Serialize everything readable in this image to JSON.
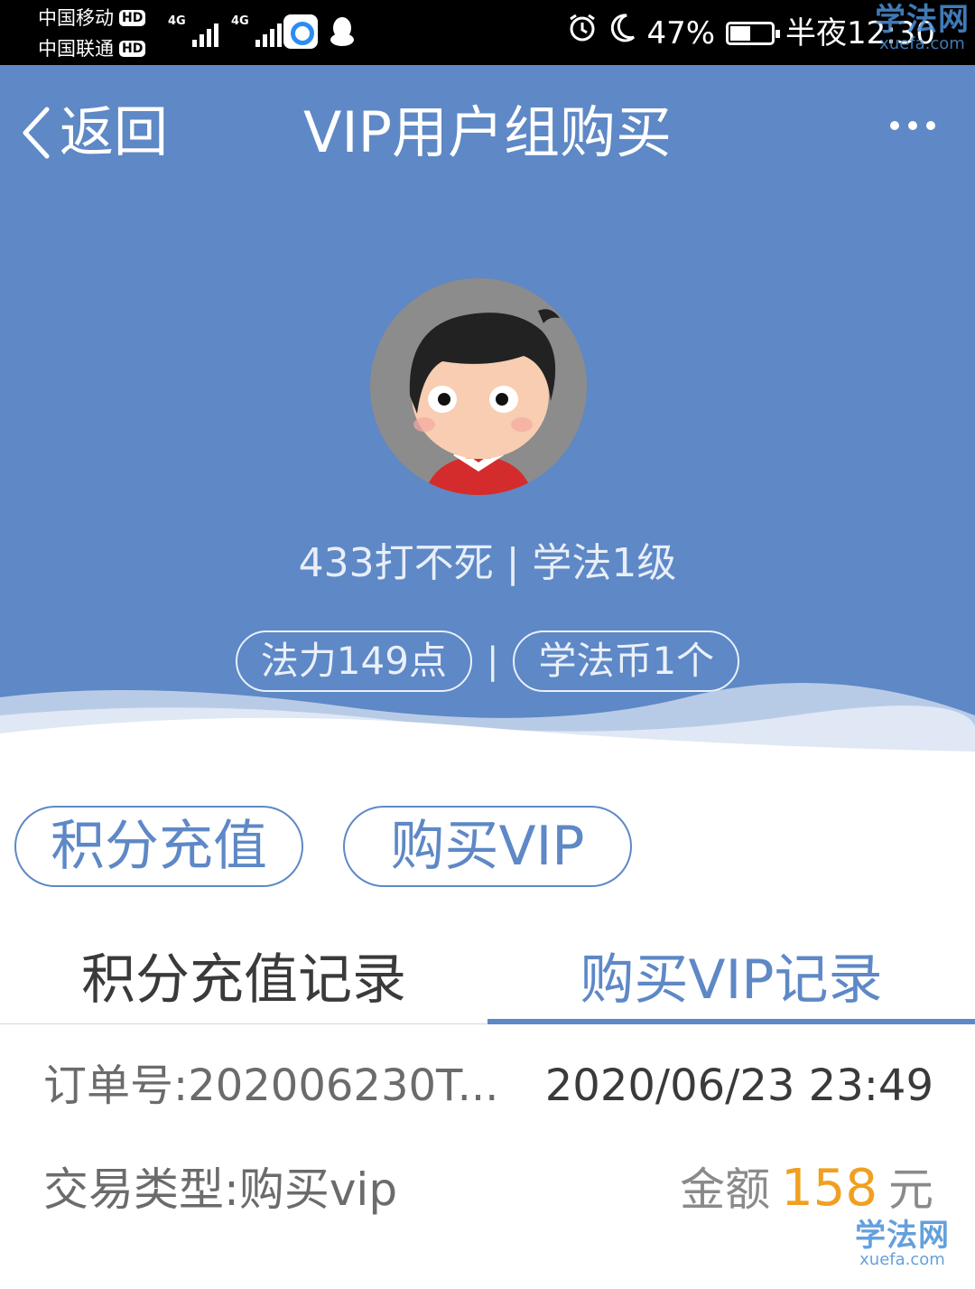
{
  "status_bar": {
    "carrier1": "中国移动",
    "carrier2": "中国联通",
    "hd_badge": "HD",
    "network_label": "4G",
    "battery_percent": "47%",
    "time": "半夜12:30"
  },
  "watermark": {
    "text": "学法网",
    "url_text": "xuefa.com"
  },
  "nav": {
    "back_label": "返回",
    "title": "VIP用户组购买"
  },
  "profile": {
    "name_line": "433打不死 | 学法1级",
    "mana_chip": "法力149点",
    "separator": "|",
    "coin_chip": "学法币1个"
  },
  "actions": {
    "recharge_label": "积分充值",
    "buy_vip_label": "购买VIP"
  },
  "tabs": [
    {
      "label": "积分充值记录",
      "active": false
    },
    {
      "label": "购买VIP记录",
      "active": true
    }
  ],
  "record": {
    "order_no": "订单号:202006230T...",
    "time": "2020/06/23 23:49",
    "trade_type": "交易类型:购买vip",
    "amount_label": "金额",
    "amount_value": "158",
    "amount_unit": "元"
  },
  "colors": {
    "header_bg": "#5e88c6",
    "accent": "#5e88c6",
    "amount": "#f0a020"
  }
}
